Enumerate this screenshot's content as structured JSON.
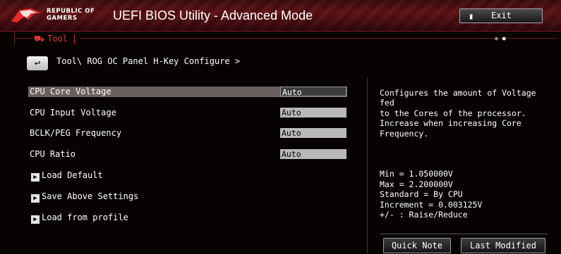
{
  "header": {
    "brand_line1": "REPUBLIC OF",
    "brand_line2": "GAMERS",
    "title": "UEFI BIOS Utility - Advanced Mode",
    "exit_label": "Exit"
  },
  "tab": {
    "label": "Tool",
    "icon": "toolbox-icon"
  },
  "breadcrumb": "Tool\\ ROG OC Panel H-Key Configure >",
  "settings": [
    {
      "label": "CPU Core Voltage",
      "value": "Auto",
      "selected": true
    },
    {
      "label": "CPU Input Voltage",
      "value": "Auto",
      "selected": false
    },
    {
      "label": "BCLK/PEG Frequency",
      "value": "Auto",
      "selected": false
    },
    {
      "label": "CPU Ratio",
      "value": "Auto",
      "selected": false
    }
  ],
  "links": [
    {
      "label": "Load Default"
    },
    {
      "label": "Save Above Settings"
    },
    {
      "label": "Load from profile"
    }
  ],
  "help": {
    "description": "Configures the amount of Voltage fed\nto the Cores of the processor.\nIncrease when increasing Core\nFrequency.",
    "details": "Min = 1.050000V\nMax = 2.200000V\nStandard = By CPU\nIncrement = 0.003125V\n+/- : Raise/Reduce"
  },
  "footer": {
    "quick_note": "Quick Note",
    "last_modified": "Last Modified"
  },
  "colors": {
    "accent": "#e23a3a",
    "header": "#5a1014",
    "selected_row": "#6b5e5e"
  }
}
